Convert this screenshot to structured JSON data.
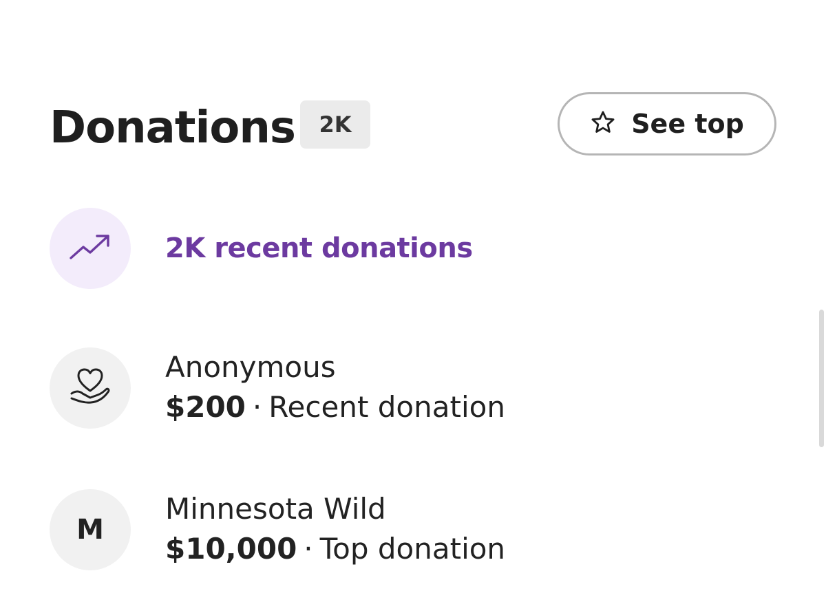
{
  "header": {
    "title": "Donations",
    "count_badge": "2K",
    "see_top_label": "See top"
  },
  "recent": {
    "label": "2K recent donations",
    "icon": "trending-up-icon",
    "accent_color": "#6c3aa0"
  },
  "donations": [
    {
      "name": "Anonymous",
      "amount": "$200",
      "separator": "·",
      "kind": "Recent donation",
      "avatar": "heart-hand-icon"
    },
    {
      "name": "Minnesota Wild",
      "amount": "$10,000",
      "separator": "·",
      "kind": "Top donation",
      "avatar_letter": "M"
    }
  ]
}
